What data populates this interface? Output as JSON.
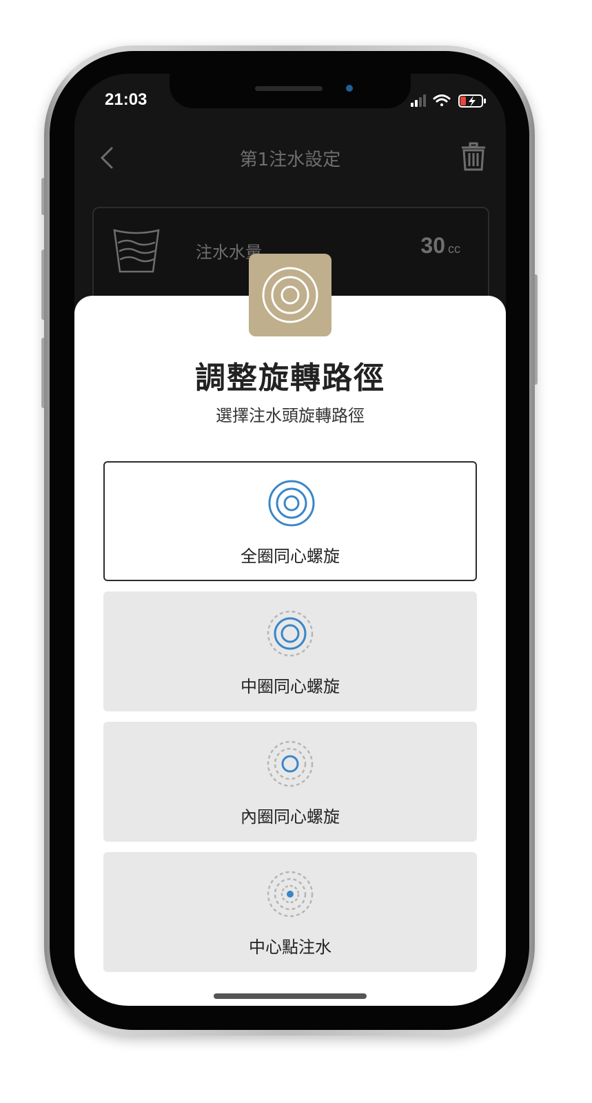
{
  "status_bar": {
    "time": "21:03"
  },
  "nav": {
    "title": "第1注水設定"
  },
  "setting_card": {
    "label": "注水水量",
    "value": "30",
    "unit": "cc"
  },
  "sheet": {
    "title": "調整旋轉路徑",
    "subtitle": "選擇注水頭旋轉路徑",
    "options": [
      {
        "label": "全圈同心螺旋",
        "selected": true
      },
      {
        "label": "中圈同心螺旋",
        "selected": false
      },
      {
        "label": "內圈同心螺旋",
        "selected": false
      },
      {
        "label": "中心點注水",
        "selected": false
      }
    ]
  },
  "colors": {
    "accent_blue": "#3a86c8",
    "badge_gold": "#bfaf8c",
    "option_bg": "#e8e8e8",
    "dashed_ring": "#b5b5b5",
    "battery_low": "#e8453c"
  },
  "icons": {
    "back": "chevron-left-icon",
    "trash": "trash-icon",
    "cup": "water-cup-icon",
    "badge": "concentric-circles-icon",
    "option_full": "full-spiral-icon",
    "option_middle": "middle-spiral-icon",
    "option_inner": "inner-spiral-icon",
    "option_center": "center-point-icon"
  }
}
